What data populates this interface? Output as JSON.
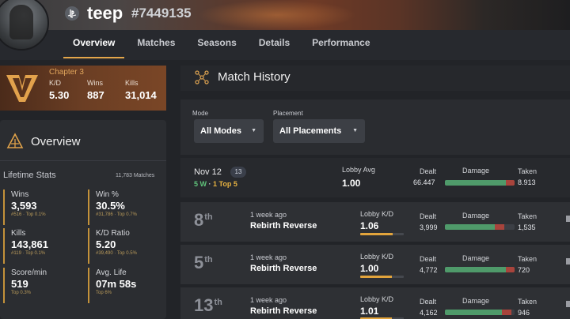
{
  "header": {
    "username": "teep",
    "tag": "#7449135",
    "platform_icon": "playstation-icon"
  },
  "nav": {
    "tabs": [
      {
        "label": "Overview",
        "active": true
      },
      {
        "label": "Matches",
        "active": false
      },
      {
        "label": "Seasons",
        "active": false
      },
      {
        "label": "Details",
        "active": false
      },
      {
        "label": "Performance",
        "active": false
      }
    ]
  },
  "chapter_card": {
    "title": "Chapter 3",
    "kd_label": "K/D",
    "kd_value": "5.30",
    "wins_label": "Wins",
    "wins_value": "887",
    "kills_label": "Kills",
    "kills_value": "31,014"
  },
  "overview": {
    "title": "Overview",
    "lifetime_label": "Lifetime Stats",
    "matches_count": "11,783 Matches",
    "stats": [
      {
        "label": "Wins",
        "value": "3,593",
        "sub": "#516 · Top 0.1%"
      },
      {
        "label": "Win %",
        "value": "30.5%",
        "sub": "#31,786 · Top 0.7%"
      },
      {
        "label": "Kills",
        "value": "143,861",
        "sub": "#119 · Top 0.1%"
      },
      {
        "label": "K/D Ratio",
        "value": "5.20",
        "sub": "#39,490 · Top 0.5%"
      },
      {
        "label": "Score/min",
        "value": "519",
        "sub": "Top 0.3%"
      },
      {
        "label": "Avg. Life",
        "value": "07m 58s",
        "sub": "Top 6%"
      }
    ]
  },
  "match_history": {
    "title": "Match History",
    "filters": {
      "mode_label": "Mode",
      "mode_value": "All Modes",
      "placement_label": "Placement",
      "placement_value": "All Placements"
    },
    "summary": {
      "date": "Nov 12",
      "count": "13",
      "wins": "5 W",
      "sep": " · ",
      "rest": "1 Top 5",
      "lobby_label": "Lobby Avg",
      "lobby_value": "1.00",
      "dealt_label": "Dealt",
      "dealt_value": "66.447",
      "damage_label": "Damage",
      "taken_label": "Taken",
      "taken_value": "8.913",
      "damage_dealt_fraction": 0.88
    },
    "matches": [
      {
        "place": "8",
        "suffix": "th",
        "ago": "1 week ago",
        "mode": "Rebirth Reverse",
        "kd_label": "Lobby K/D",
        "kd": "1.06",
        "kd_fraction": 0.75,
        "dealt_label": "Dealt",
        "dealt": "3,999",
        "damage_label": "Damage",
        "taken_label": "Taken",
        "taken": "1,535",
        "damage_dealt_fraction": 0.72
      },
      {
        "place": "5",
        "suffix": "th",
        "ago": "1 week ago",
        "mode": "Rebirth Reverse",
        "kd_label": "Lobby K/D",
        "kd": "1.00",
        "kd_fraction": 0.72,
        "dealt_label": "Dealt",
        "dealt": "4,772",
        "damage_label": "Damage",
        "taken_label": "Taken",
        "taken": "720",
        "damage_dealt_fraction": 0.87
      },
      {
        "place": "13",
        "suffix": "th",
        "ago": "1 week ago",
        "mode": "Rebirth Reverse",
        "kd_label": "Lobby K/D",
        "kd": "1.01",
        "kd_fraction": 0.73,
        "dealt_label": "Dealt",
        "dealt": "4,162",
        "damage_label": "Damage",
        "taken_label": "Taken",
        "taken": "946",
        "damage_dealt_fraction": 0.82
      }
    ]
  },
  "colors": {
    "accent": "#e4a64a",
    "win_green": "#5fc27a",
    "top5_gold": "#e8b341",
    "damage_dealt": "#4f9a6a",
    "damage_taken": "#a8443c"
  }
}
